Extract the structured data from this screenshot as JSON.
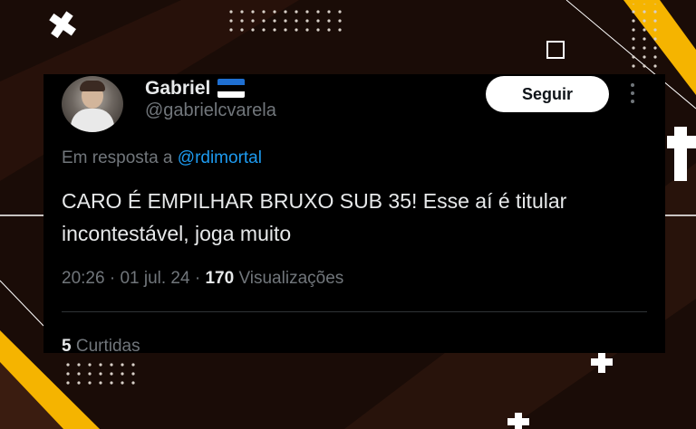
{
  "tweet": {
    "display_name": "Gabriel",
    "handle": "@gabrielcvarela",
    "follow_label": "Seguir",
    "reply_prefix": "Em resposta a",
    "reply_to": "@rdimortal",
    "text_line1": "CARO É EMPILHAR BRUXO SUB 35! Esse aí é titular",
    "text_line2": "incontestável, joga muito",
    "time": "20:26",
    "sep1": "·",
    "date": "01 jul. 24",
    "sep2": "·",
    "views_count": "170",
    "views_label": "Visualizações",
    "likes_count": "5",
    "likes_label": "Curtidas"
  },
  "icons": {
    "flag": "estonia-flag-icon",
    "more": "more-options-icon"
  },
  "colors": {
    "background": "#1a0c07",
    "card": "#000000",
    "accent_yellow": "#f5b400",
    "link": "#1d9bf0",
    "flag_blue": "#1f6fd1",
    "flag_black": "#000000",
    "flag_white": "#ffffff"
  }
}
